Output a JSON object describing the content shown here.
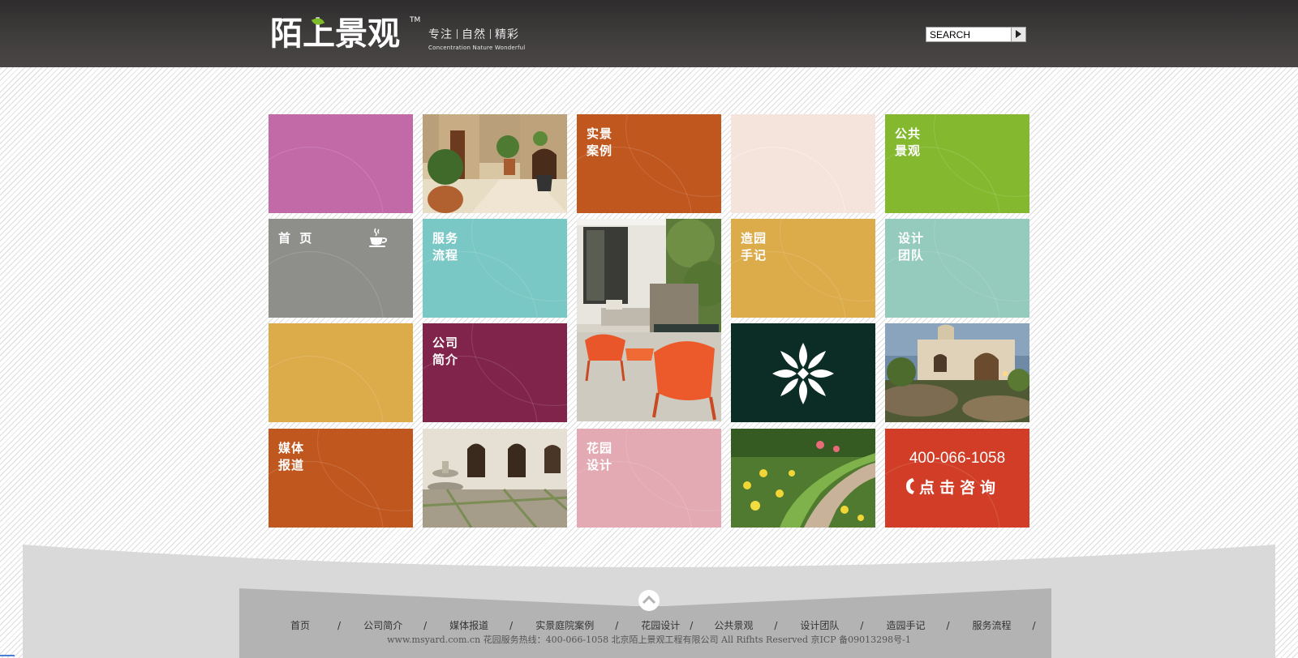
{
  "header": {
    "logo_text": "陌上景观",
    "logo_tm": "TM",
    "slogan_parts": [
      "专注",
      "自然",
      "精彩"
    ],
    "slogan_en": "Concentration   Nature   Wonderful",
    "search_placeholder": "SEARCH"
  },
  "tiles": {
    "cases": "实景\n案例",
    "public": "公共\n景观",
    "home": "首 页",
    "service": "服务\n流程",
    "notes": "造园\n手记",
    "team": "设计\n团队",
    "about": "公司\n简介",
    "media": "媒体\n报道",
    "garden": "花园\n设计",
    "phone": "400-066-1058",
    "consult": "点击咨询"
  },
  "colors": {
    "magenta": "#c269a8",
    "orange": "#c0571f",
    "peach": "#f5e4dc",
    "green": "#84b92f",
    "gray": "#8e8e8b",
    "teal": "#7ac8c6",
    "mustard": "#dcac4b",
    "mint": "#94cbbd",
    "plum": "#80244b",
    "darkgreen": "#0c2c26",
    "pink": "#e3aab3",
    "red": "#d13d27"
  },
  "icons": [
    "coffee-cup-icon",
    "floral-emblem-icon",
    "phone-icon",
    "up-arrow-icon",
    "search-arrow-icon"
  ],
  "footer": {
    "nav": [
      "首页",
      "公司简介",
      "媒体报道",
      "实景庭院案例",
      "花园设计",
      "公共景观",
      "设计团队",
      "造园手记",
      "服务流程"
    ],
    "separator": "/",
    "copyright": "www.msyard.com.cn 花园服务热线：400-066-1058 北京陌上景观工程有限公司 All Rifhts Reserved 京ICP 备09013298号-1"
  }
}
